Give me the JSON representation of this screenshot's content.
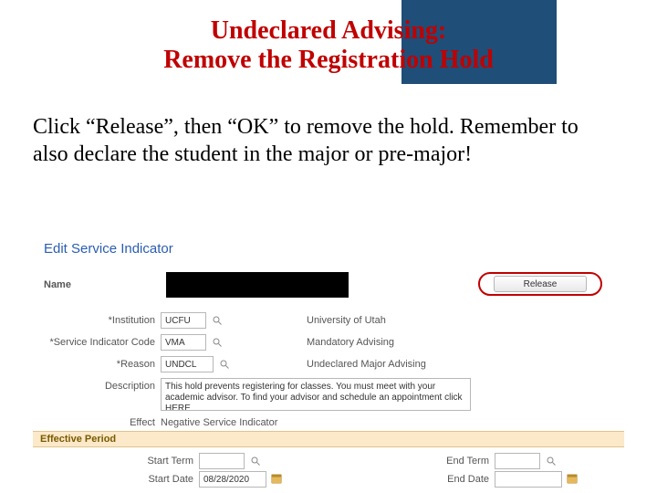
{
  "title": {
    "line1": "Undeclared Advising:",
    "line2": "Remove the Registration Hold"
  },
  "body": "Click “Release”, then “OK” to remove the hold. Remember to also declare the student in the major or pre-major!",
  "screenshot": {
    "header": "Edit Service Indicator",
    "labels": {
      "name": "Name",
      "institution": "*Institution",
      "sic": "*Service Indicator Code",
      "reason": "*Reason",
      "description": "Description",
      "effect": "Effect",
      "start_term": "Start Term",
      "end_term": "End Term",
      "start_date": "Start Date",
      "end_date": "End Date"
    },
    "values": {
      "release_btn": "Release",
      "institution_code": "UCFU",
      "institution_name": "University of Utah",
      "sic_code": "VMA",
      "sic_name": "Mandatory Advising",
      "reason_code": "UNDCL",
      "reason_name": "Undeclared Major Advising",
      "description_text": "This hold prevents registering for classes. You must meet with your academic advisor. To find your advisor and schedule an appointment click  HERE",
      "effect_text": "Negative Service Indicator",
      "start_term": "",
      "end_term": "",
      "start_date": "08/28/2020",
      "end_date": ""
    },
    "section": "Effective Period"
  }
}
